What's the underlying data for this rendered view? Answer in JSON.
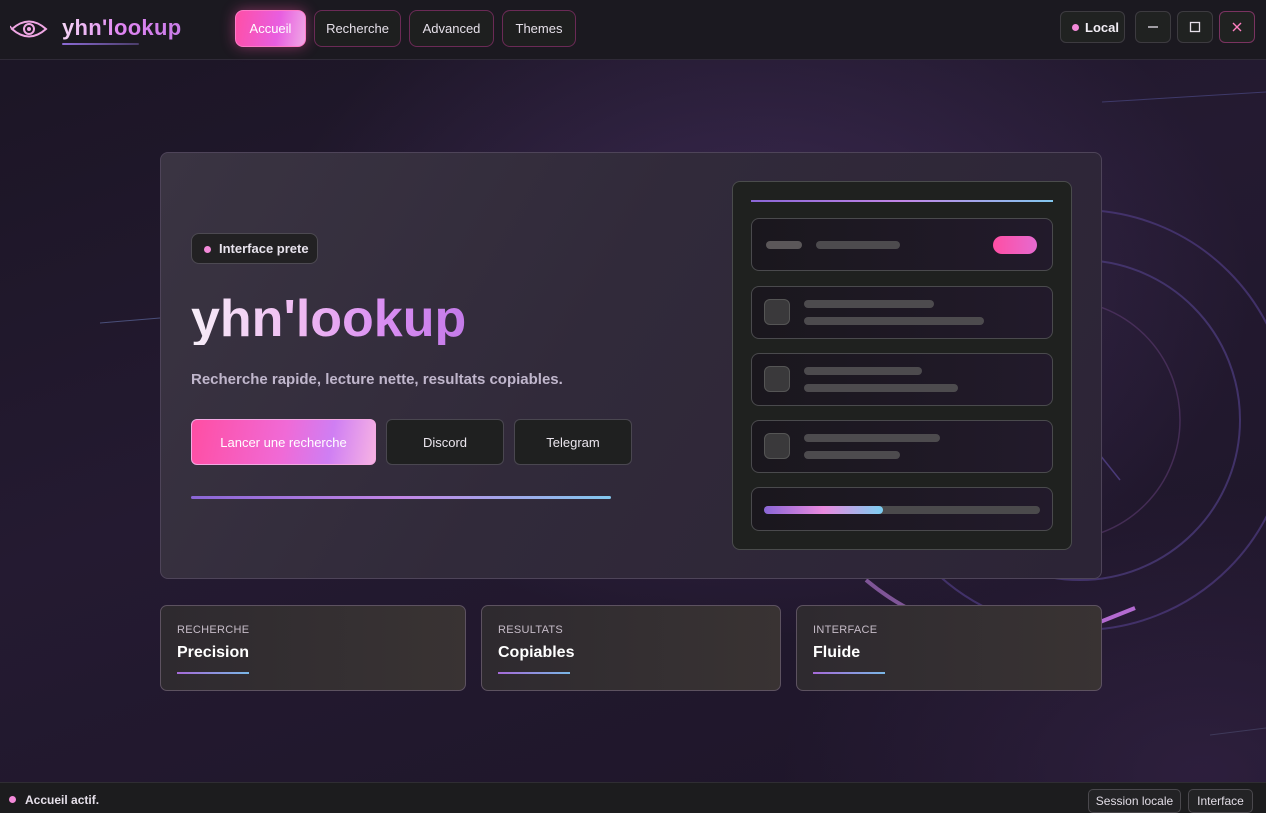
{
  "app": {
    "brand": "yhn'lookup"
  },
  "nav": {
    "tabs": [
      {
        "label": "Accueil",
        "active": true
      },
      {
        "label": "Recherche",
        "active": false
      },
      {
        "label": "Advanced",
        "active": false
      },
      {
        "label": "Themes",
        "active": false
      }
    ]
  },
  "window": {
    "mode_label": "Local"
  },
  "hero": {
    "badge": "Interface prete",
    "title": "yhn'lookup",
    "subtitle": "Recherche rapide, lecture nette, resultats copiables.",
    "buttons": {
      "primary": "Lancer une recherche",
      "discord": "Discord",
      "telegram": "Telegram"
    },
    "preview_progress": 0.43
  },
  "cards": [
    {
      "kicker": "RECHERCHE",
      "title": "Precision"
    },
    {
      "kicker": "RESULTATS",
      "title": "Copiables"
    },
    {
      "kicker": "INTERFACE",
      "title": "Fluide"
    }
  ],
  "status": {
    "text": "Accueil actif.",
    "buttons": [
      "Session locale",
      "Interface"
    ]
  },
  "colors": {
    "accent_pink": "#ff4fa6",
    "accent_purple": "#c97ce8",
    "accent_blue": "#82c7ee"
  }
}
